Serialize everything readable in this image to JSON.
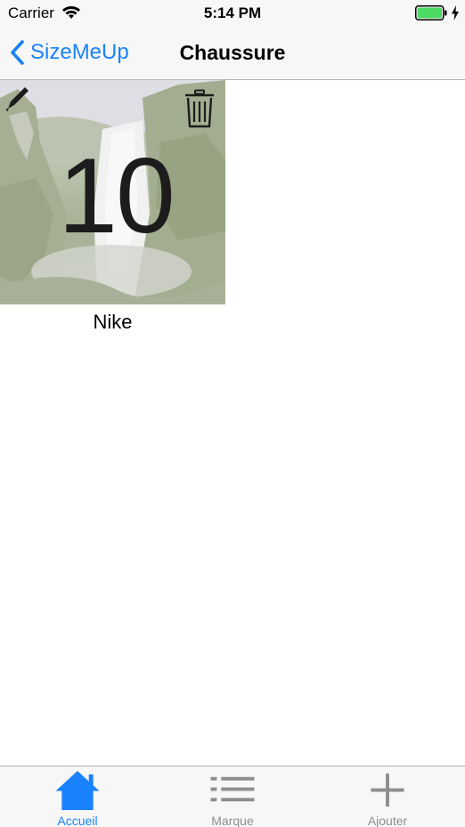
{
  "status_bar": {
    "carrier": "Carrier",
    "time": "5:14 PM",
    "battery_color": "#4cd964"
  },
  "nav_bar": {
    "back_label": "SizeMeUp",
    "title": "Chaussure",
    "tint_color": "#1a82fb"
  },
  "items": [
    {
      "size": "10",
      "brand": "Nike",
      "edit_icon": "pencil-icon",
      "delete_icon": "trash-icon"
    }
  ],
  "tab_bar": {
    "tabs": [
      {
        "label": "Accueil",
        "icon": "home-icon",
        "active": true
      },
      {
        "label": "Marque",
        "icon": "list-icon",
        "active": false
      },
      {
        "label": "Ajouter",
        "icon": "plus-icon",
        "active": false
      }
    ],
    "active_color": "#1a82fb",
    "inactive_color": "#8e8e8e"
  }
}
